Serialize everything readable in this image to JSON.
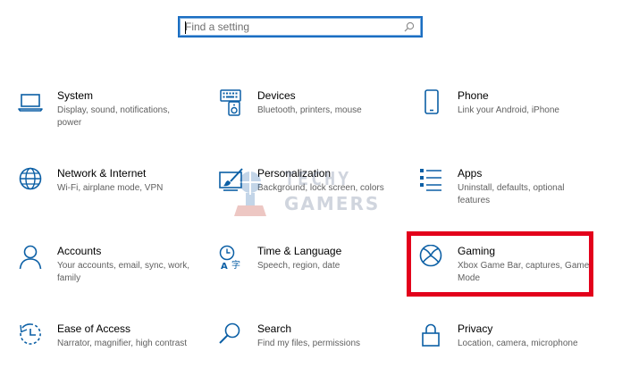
{
  "search": {
    "placeholder": "Find a setting"
  },
  "accent_color": "#0b5fa5",
  "highlight_color": "#e3001b",
  "tiles": [
    {
      "title": "System",
      "desc": "Display, sound, notifications, power",
      "icon": "laptop-icon"
    },
    {
      "title": "Devices",
      "desc": "Bluetooth, printers, mouse",
      "icon": "keyboard-speaker-icon"
    },
    {
      "title": "Phone",
      "desc": "Link your Android, iPhone",
      "icon": "phone-icon"
    },
    {
      "title": "Network & Internet",
      "desc": "Wi-Fi, airplane mode, VPN",
      "icon": "globe-icon"
    },
    {
      "title": "Personalization",
      "desc": "Background, lock screen, colors",
      "icon": "paint-brush-icon"
    },
    {
      "title": "Apps",
      "desc": "Uninstall, defaults, optional features",
      "icon": "apps-list-icon"
    },
    {
      "title": "Accounts",
      "desc": "Your accounts, email, sync, work, family",
      "icon": "person-icon"
    },
    {
      "title": "Time & Language",
      "desc": "Speech, region, date",
      "icon": "time-language-icon"
    },
    {
      "title": "Gaming",
      "desc": "Xbox Game Bar, captures, Game Mode",
      "icon": "xbox-icon"
    },
    {
      "title": "Ease of Access",
      "desc": "Narrator, magnifier, high contrast",
      "icon": "ease-of-access-icon"
    },
    {
      "title": "Search",
      "desc": "Find my files, permissions",
      "icon": "magnifier-icon"
    },
    {
      "title": "Privacy",
      "desc": "Location, camera, microphone",
      "icon": "lock-icon"
    }
  ],
  "watermark": {
    "line1": "TECHY",
    "line2": "GAMERS"
  }
}
